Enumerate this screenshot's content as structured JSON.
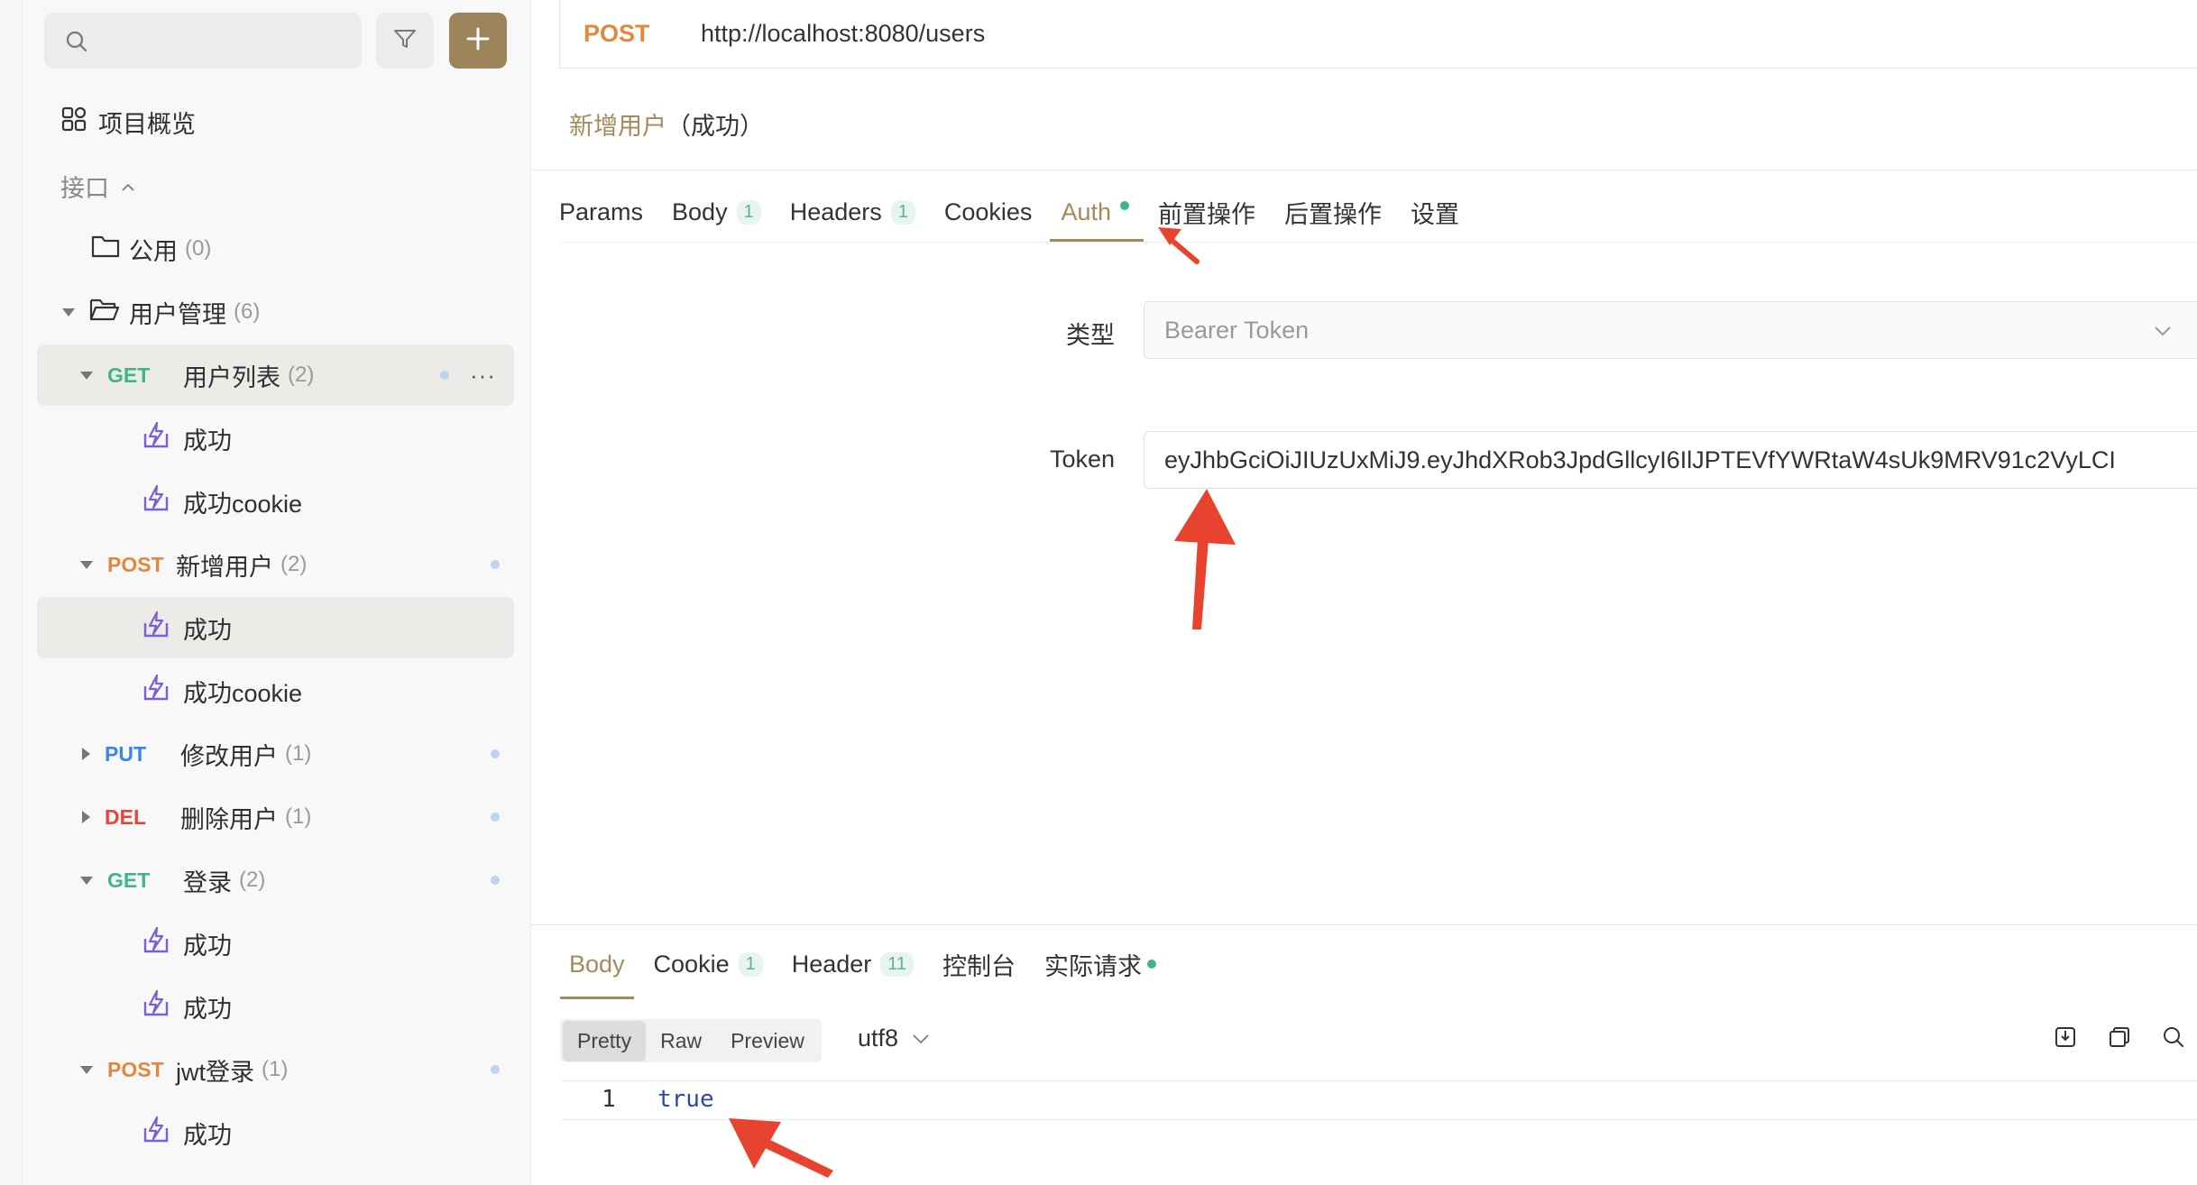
{
  "request": {
    "method": "POST",
    "url": "http://localhost:8080/users",
    "case_name": "新增用户",
    "case_suffix": "（成功）"
  },
  "sidebar": {
    "overview": "项目概览",
    "section": "接口",
    "folder_public": {
      "name": "公用",
      "count": "(0)"
    },
    "folder_users": {
      "name": "用户管理",
      "count": "(6)"
    },
    "items": [
      {
        "method": "GET",
        "name": "用户列表",
        "count": "(2)"
      },
      {
        "name": "成功"
      },
      {
        "name": "成功cookie"
      },
      {
        "method": "POST",
        "name": "新增用户",
        "count": "(2)"
      },
      {
        "name": "成功"
      },
      {
        "name": "成功cookie"
      },
      {
        "method": "PUT",
        "name": "修改用户",
        "count": "(1)"
      },
      {
        "method": "DEL",
        "name": "删除用户",
        "count": "(1)"
      },
      {
        "method": "GET",
        "name": "登录",
        "count": "(2)"
      },
      {
        "name": "成功"
      },
      {
        "name": "成功"
      },
      {
        "method": "POST",
        "name": "jwt登录",
        "count": "(1)"
      },
      {
        "name": "成功"
      }
    ],
    "more": "···"
  },
  "tabs": [
    {
      "label": "Params"
    },
    {
      "label": "Body",
      "badge": "1"
    },
    {
      "label": "Headers",
      "badge": "1"
    },
    {
      "label": "Cookies"
    },
    {
      "label": "Auth"
    },
    {
      "label": "前置操作"
    },
    {
      "label": "后置操作"
    },
    {
      "label": "设置"
    }
  ],
  "auth": {
    "type_label": "类型",
    "type_value": "Bearer Token",
    "token_label": "Token",
    "token_value": "eyJhbGciOiJIUzUxMiJ9.eyJhdXRob3JpdGllcyI6IlJPTEVfYWRtaW4sUk9MRV91c2VyLCI"
  },
  "response": {
    "tabs": [
      {
        "label": "Body"
      },
      {
        "label": "Cookie",
        "badge": "1"
      },
      {
        "label": "Header",
        "badge": "11"
      },
      {
        "label": "控制台"
      },
      {
        "label": "实际请求"
      }
    ],
    "views": [
      "Pretty",
      "Raw",
      "Preview"
    ],
    "encoding": "utf8",
    "line_number": "1",
    "body": "true"
  },
  "colors": {
    "accent": "#9b835a",
    "get": "#3fb58b",
    "post": "#e0883f",
    "put": "#3a86e6",
    "del": "#e0473d",
    "annotation_arrow": "#e8432f"
  }
}
